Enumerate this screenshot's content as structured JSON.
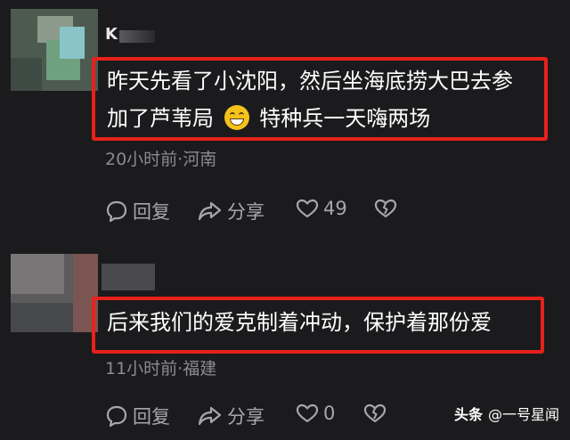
{
  "comments": [
    {
      "username": "K",
      "content_line1": "昨天先看了小沈阳，然后坐海底捞大巴去参",
      "content_line2_pre": "加了芦苇局",
      "content_line2_post": "特种兵一天嗨两场",
      "emoji": "grinning-face-emoji",
      "meta": "20小时前·河南",
      "reply_label": "回复",
      "share_label": "分享",
      "like_count": "49"
    },
    {
      "username": "",
      "content_line1": "后来我们的爱克制着冲动，保护着那份爱",
      "meta": "11小时前·福建",
      "reply_label": "回复",
      "share_label": "分享",
      "like_count": "0"
    }
  ],
  "watermark": {
    "brand": "头条",
    "handle": "@一号星闻"
  },
  "colors": {
    "background": "#1b1b1d",
    "highlight_border": "#e8211b",
    "meta_text": "#8b8b8f",
    "action_text": "#a7a7ab"
  }
}
